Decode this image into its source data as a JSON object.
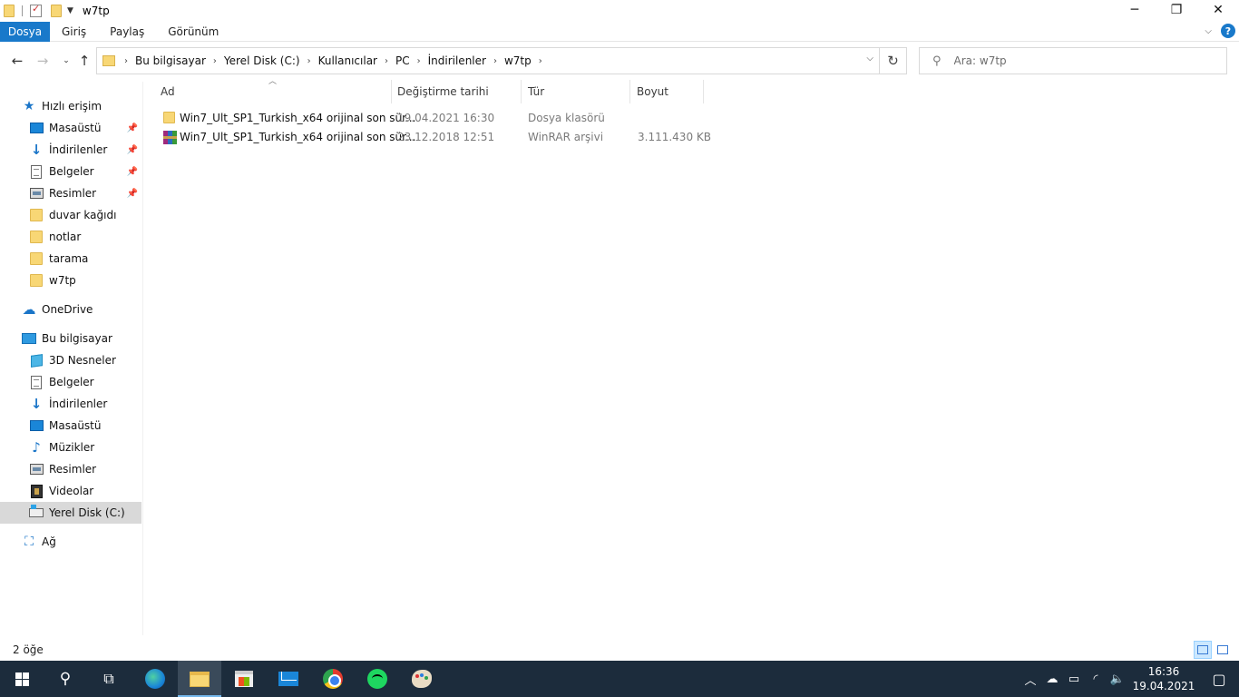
{
  "window": {
    "title": "w7tp",
    "minimize": "─",
    "maximize": "❐",
    "close": "✕"
  },
  "ribbon": {
    "tabs": [
      "Dosya",
      "Giriş",
      "Paylaş",
      "Görünüm"
    ],
    "help": "?"
  },
  "address": {
    "crumbs": [
      "Bu bilgisayar",
      "Yerel Disk (C:)",
      "Kullanıcılar",
      "PC",
      "İndirilenler",
      "w7tp"
    ],
    "search_placeholder": "Ara: w7tp"
  },
  "sidebar": {
    "quick_access": "Hızlı erişim",
    "quick_items": [
      {
        "label": "Masaüstü",
        "icon": "desktop-icon",
        "pinned": true
      },
      {
        "label": "İndirilenler",
        "icon": "download-icon",
        "pinned": true
      },
      {
        "label": "Belgeler",
        "icon": "documents-icon",
        "pinned": true
      },
      {
        "label": "Resimler",
        "icon": "pictures-icon",
        "pinned": true
      },
      {
        "label": "duvar kağıdı",
        "icon": "folder-icon",
        "pinned": false
      },
      {
        "label": "notlar",
        "icon": "folder-icon",
        "pinned": false
      },
      {
        "label": "tarama",
        "icon": "folder-icon",
        "pinned": false
      },
      {
        "label": "w7tp",
        "icon": "folder-icon",
        "pinned": false
      }
    ],
    "onedrive": "OneDrive",
    "this_pc": "Bu bilgisayar",
    "pc_items": [
      {
        "label": "3D Nesneler",
        "icon": "3d-objects-icon"
      },
      {
        "label": "Belgeler",
        "icon": "documents-icon"
      },
      {
        "label": "İndirilenler",
        "icon": "download-icon"
      },
      {
        "label": "Masaüstü",
        "icon": "desktop-icon"
      },
      {
        "label": "Müzikler",
        "icon": "music-icon"
      },
      {
        "label": "Resimler",
        "icon": "pictures-icon"
      },
      {
        "label": "Videolar",
        "icon": "videos-icon"
      },
      {
        "label": "Yerel Disk (C:)",
        "icon": "local-disk-icon",
        "selected": true
      }
    ],
    "network": "Ağ"
  },
  "files": {
    "columns": [
      "Ad",
      "Değiştirme tarihi",
      "Tür",
      "Boyut"
    ],
    "rows": [
      {
        "name": "Win7_Ult_SP1_Turkish_x64 orijinal son sür...",
        "date": "19.04.2021 16:30",
        "type": "Dosya klasörü",
        "size": "",
        "icon": "folder-icon"
      },
      {
        "name": "Win7_Ult_SP1_Turkish_x64 orijinal son sür...",
        "date": "23.12.2018 12:51",
        "type": "WinRAR arşivi",
        "size": "3.111.430 KB",
        "icon": "winrar-archive-icon"
      }
    ]
  },
  "status": {
    "item_count": "2 öğe"
  },
  "taskbar": {
    "apps": [
      "start-icon",
      "search-icon",
      "task-view-icon",
      "edge-icon",
      "file-explorer-icon",
      "store-icon",
      "mail-icon",
      "chrome-icon",
      "spotify-icon",
      "paint-icon"
    ],
    "time": "16:36",
    "date": "19.04.2021"
  }
}
